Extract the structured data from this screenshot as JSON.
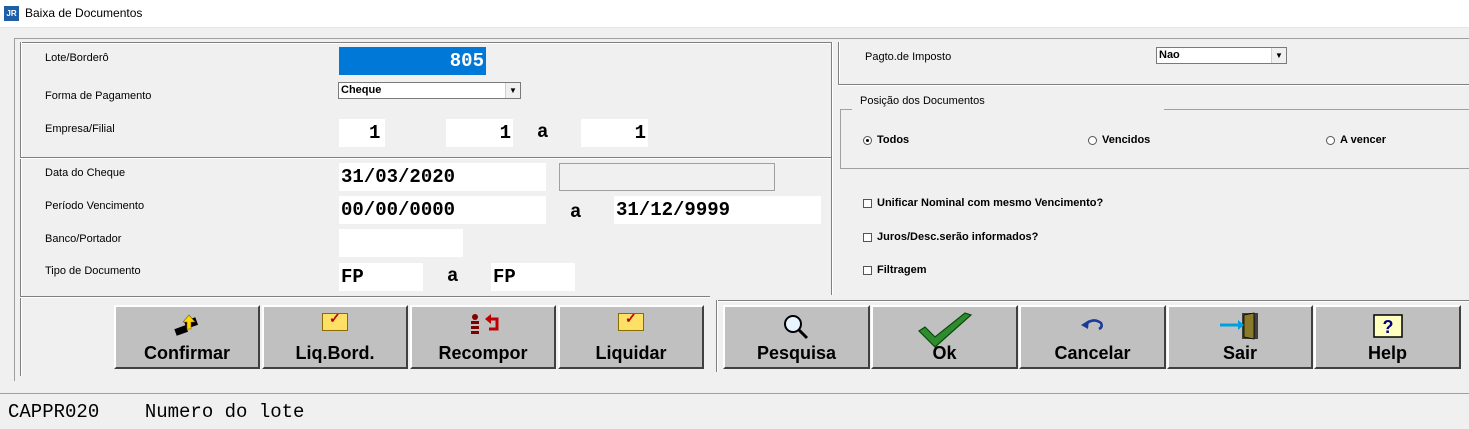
{
  "window": {
    "icon_text": "JR",
    "title": "Baixa de Documentos"
  },
  "left_top": {
    "lote_label": "Lote/Borderô",
    "lote_value": "805",
    "forma_label": "Forma de Pagamento",
    "forma_value": "Cheque",
    "empresa_label": "Empresa/Filial",
    "empresa_value": "1",
    "filial_from": "1",
    "filial_sep": "a",
    "filial_to": "1"
  },
  "left_bottom": {
    "data_cheque_label": "Data do Cheque",
    "data_cheque_value": "31/03/2020",
    "periodo_label": "Período Vencimento",
    "periodo_from": "00/00/0000",
    "periodo_sep": "a",
    "periodo_to": "31/12/9999",
    "banco_label": "Banco/Portador",
    "banco_value": "",
    "tipo_label": "Tipo de Documento",
    "tipo_from": "FP",
    "tipo_sep": "a",
    "tipo_to": "FP"
  },
  "right": {
    "imposto_label": "Pagto.de Imposto",
    "imposto_value": "Nao",
    "posicao_title": "Posição dos Documentos",
    "radios": [
      {
        "label": "Todos",
        "checked": true
      },
      {
        "label": "Vencidos",
        "checked": false
      },
      {
        "label": "A vencer",
        "checked": false
      }
    ],
    "checks": [
      {
        "label": "Unificar Nominal com mesmo Vencimento?",
        "checked": false
      },
      {
        "label": "Juros/Desc.serão informados?",
        "checked": false
      },
      {
        "label": "Filtragem",
        "checked": false
      }
    ]
  },
  "buttons_left": [
    {
      "label": "Confirmar",
      "icon": "confirm-icon"
    },
    {
      "label": "Liq.Bord.",
      "icon": "folder-check-icon"
    },
    {
      "label": "Recompor",
      "icon": "recompose-icon"
    },
    {
      "label": "Liquidar",
      "icon": "folder-check-icon"
    }
  ],
  "buttons_right": [
    {
      "label": "Pesquisa",
      "icon": "magnifier-icon"
    },
    {
      "label": "Ok",
      "icon": "checkmark-icon"
    },
    {
      "label": "Cancelar",
      "icon": "undo-icon"
    },
    {
      "label": "Sair",
      "icon": "exit-door-icon"
    },
    {
      "label": "Help",
      "icon": "help-icon"
    }
  ],
  "status_bar": {
    "code": "CAPPR020",
    "message": "Numero do lote"
  },
  "colors": {
    "selection": "#0078d7",
    "button_face": "#c0c0c0",
    "window_bg": "#f0f0f0"
  }
}
